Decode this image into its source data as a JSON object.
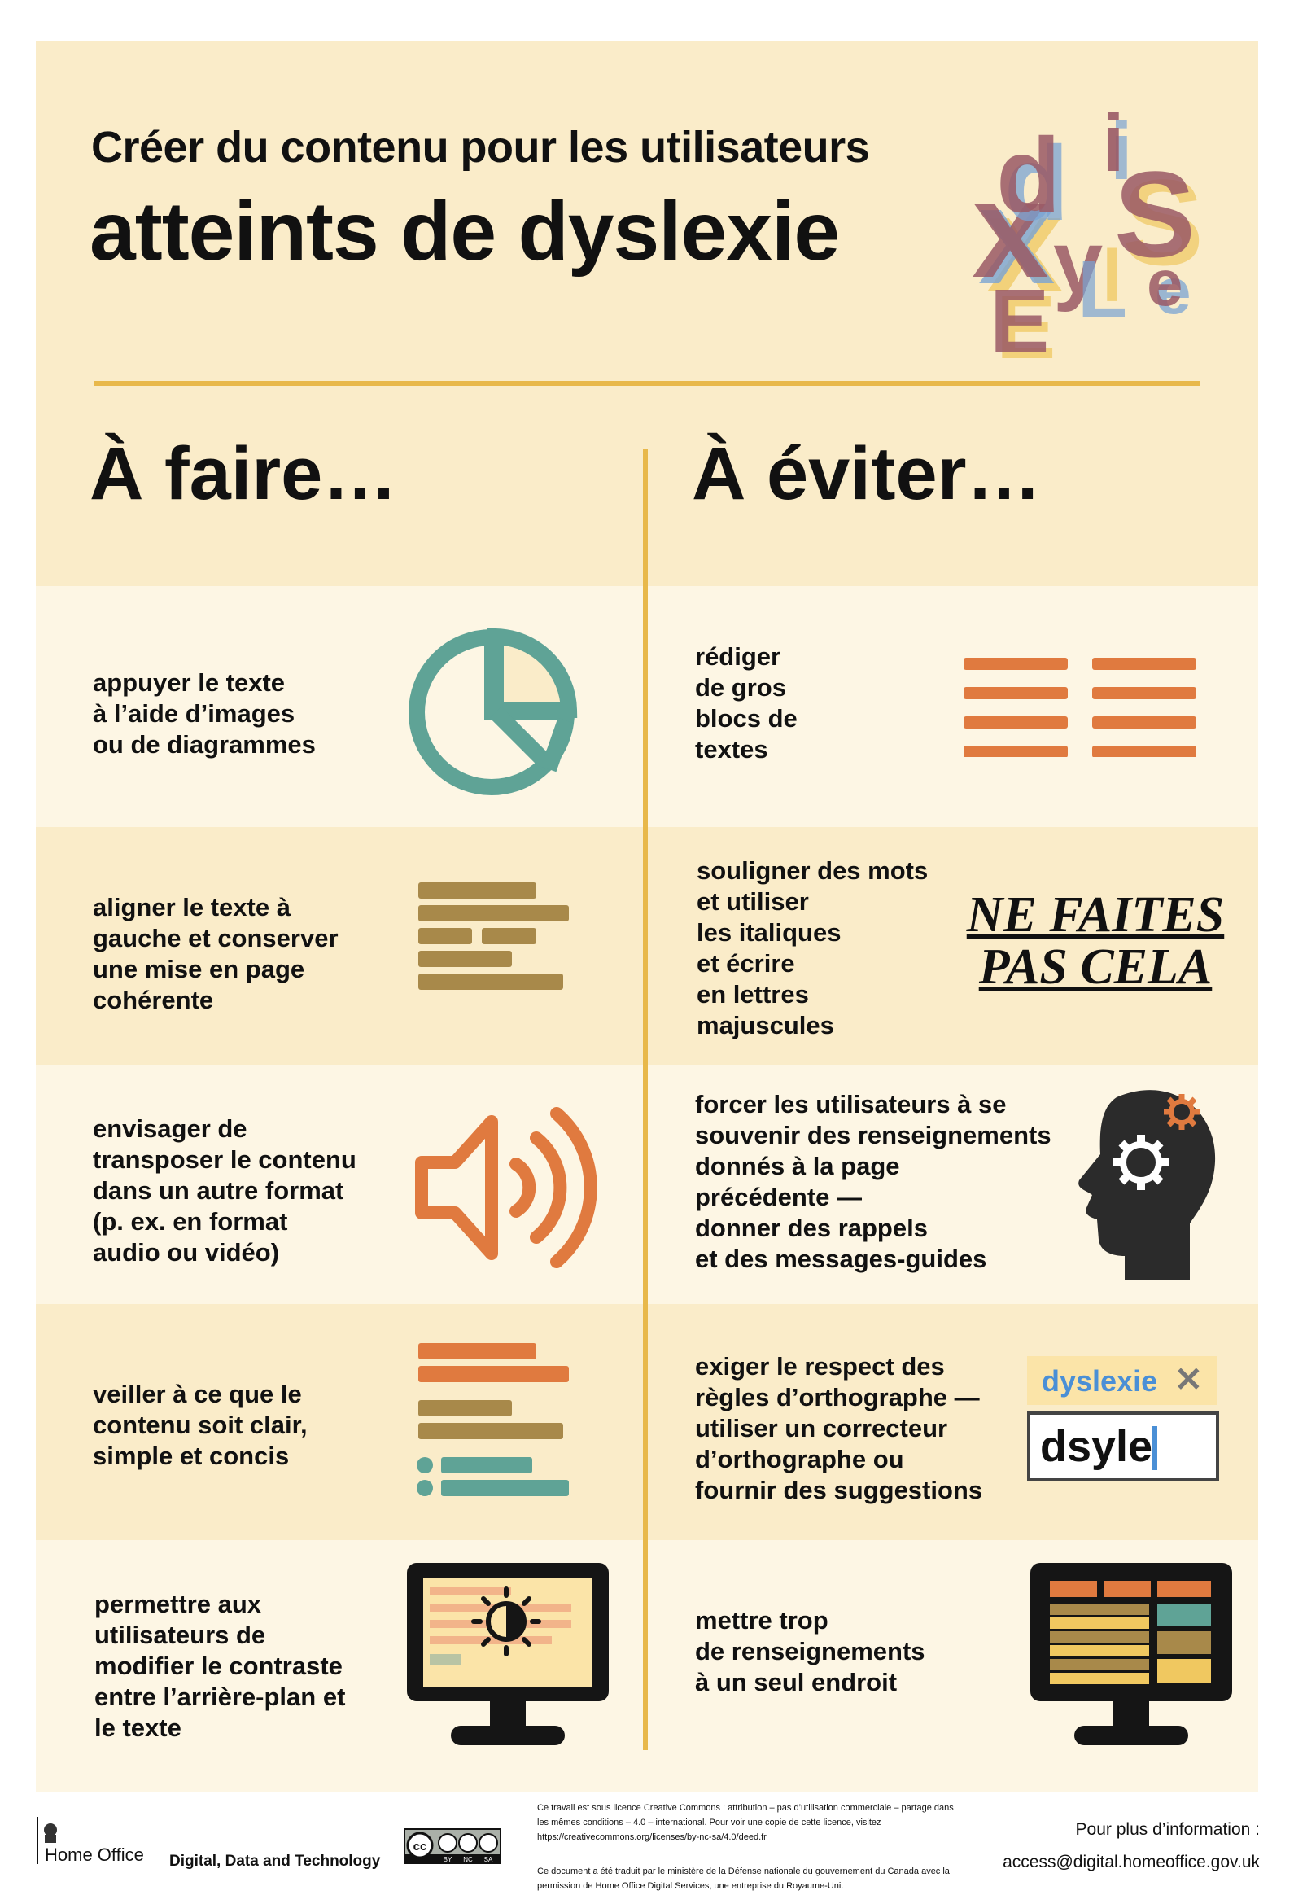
{
  "header": {
    "title_line1": "Créer du contenu pour les utilisateurs",
    "title_line2": "atteints de dyslexie",
    "logo_letters": [
      "d",
      "i",
      "s",
      "y",
      "l",
      "e",
      "x",
      "i",
      "e"
    ]
  },
  "columns": {
    "do_heading": "À faire…",
    "dont_heading": "À éviter…"
  },
  "rows": [
    {
      "do": "appuyer le texte\nà l’aide d’images\nou de diagrammes",
      "do_icon": "pie-chart-icon",
      "dont": "rédiger\nde gros\nblocs de\ntextes",
      "dont_icon": "text-blocks-icon"
    },
    {
      "do": "aligner le texte à\ngauche et conserver\nune mise en page\ncohérente",
      "do_icon": "left-aligned-text-icon",
      "dont": "souligner des mots\net utiliser\nles italiques\net écrire\nen lettres\nmajuscules",
      "dont_example": "NE FAITES\nPAS CELA"
    },
    {
      "do": "envisager de\ntransposer le contenu\ndans un autre format\n(p. ex. en format\naudio ou vidéo)",
      "do_icon": "speaker-icon",
      "dont": "forcer les utilisateurs à se\nsouvenir des renseignements\ndonnés à la page\nprécédente —\ndonner des rappels\net des messages-guides",
      "dont_icon": "head-gears-icon"
    },
    {
      "do": "veiller à ce que le\ncontenu soit clair,\nsimple et concis",
      "do_icon": "clear-text-icon",
      "dont": "exiger le respect des\nrègles d’orthographe —\nutiliser un correcteur\nd’orthographe ou\nfournir des suggestions",
      "spell_suggestion": "dyslexie",
      "spell_typed": "dsyle"
    },
    {
      "do": "permettre aux\nutilisateurs de\nmodifier le contraste\nentre l’arrière-plan et\nle texte",
      "do_icon": "monitor-contrast-icon",
      "dont": "mettre trop\nde renseignements\nà un seul endroit",
      "dont_icon": "monitor-cluttered-icon"
    }
  ],
  "footer": {
    "org": "Home Office",
    "team": "Digital, Data and Technology",
    "cc_labels": [
      "BY",
      "NC",
      "SA"
    ],
    "license_text": "Ce travail est sous licence Creative Commons : attribution – pas d’utilisation commerciale – partage dans les mêmes conditions – 4.0 – international. Pour voir une copie de cette licence, visitez https://creativecommons.org/licenses/by-nc-sa/4.0/deed.fr",
    "translation_text": "Ce document a été traduit par le ministère de la Défense nationale du gouvernement du Canada avec la permission de Home Office Digital Services, une entreprise du Royaume-Uni.",
    "more_info_label": "Pour plus d’information :",
    "contact_email": "access@digital.homeoffice.gov.uk"
  },
  "colors": {
    "background": "#faecc9",
    "band_light": "#fdf6e4",
    "accent_gold": "#e8b84a",
    "teal": "#5fa396",
    "orange": "#e07a3f",
    "olive": "#a8894a",
    "dark": "#2b2b2b",
    "blue": "#4a8fd6"
  }
}
